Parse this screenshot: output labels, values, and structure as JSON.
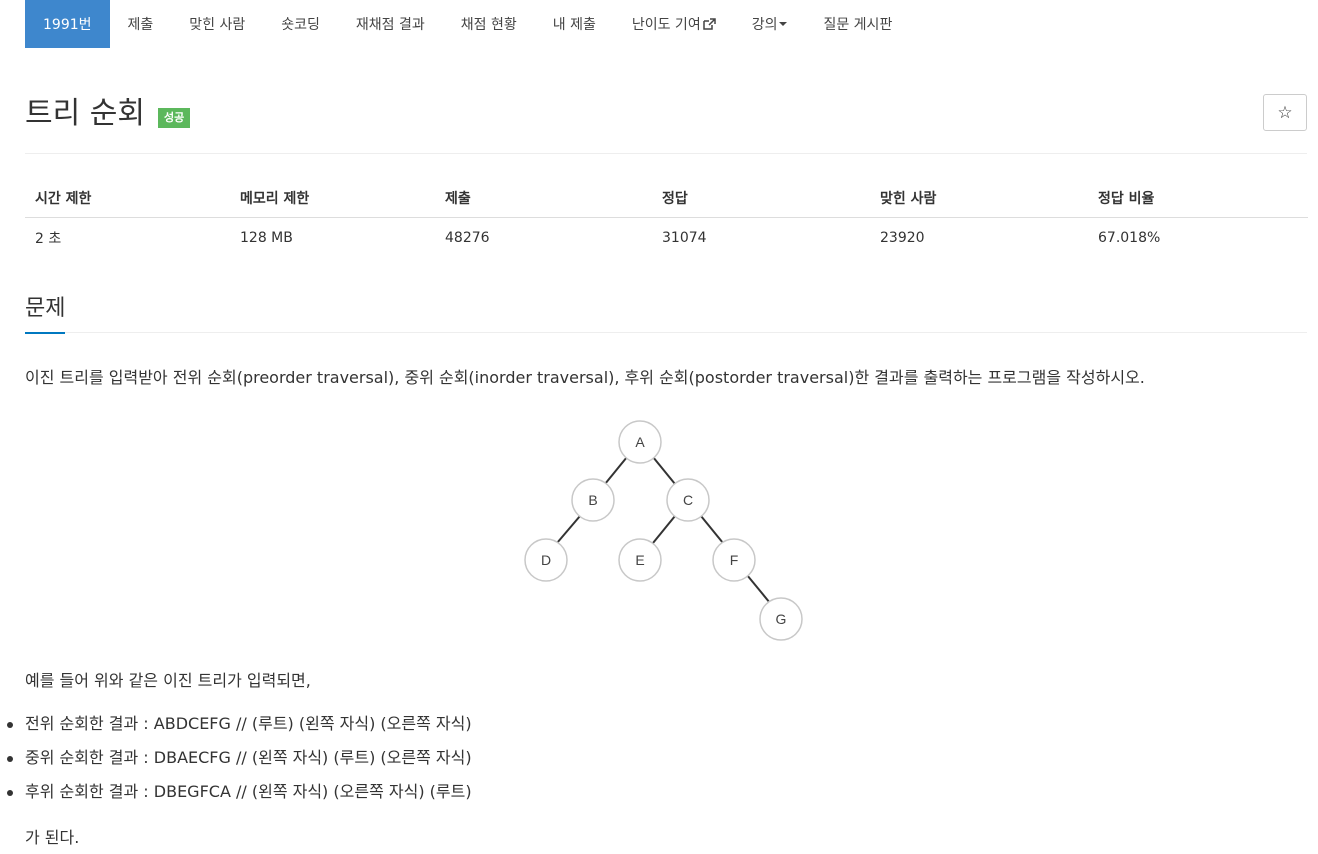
{
  "nav": {
    "tabs": [
      {
        "label": "1991번",
        "active": true
      },
      {
        "label": "제출"
      },
      {
        "label": "맞힌 사람"
      },
      {
        "label": "숏코딩"
      },
      {
        "label": "재채점 결과"
      },
      {
        "label": "채점 현황"
      },
      {
        "label": "내 제출"
      },
      {
        "label": "난이도 기여"
      },
      {
        "label": "강의"
      },
      {
        "label": "질문 게시판"
      }
    ]
  },
  "problem": {
    "title": "트리 순회",
    "badge": "성공",
    "star": "☆"
  },
  "info": {
    "headers": [
      "시간 제한",
      "메모리 제한",
      "제출",
      "정답",
      "맞힌 사람",
      "정답 비율"
    ],
    "values": [
      "2 초",
      "128 MB",
      "48276",
      "31074",
      "23920",
      "67.018%"
    ]
  },
  "section": {
    "title": "문제",
    "description": "이진 트리를 입력받아 전위 순회(preorder traversal), 중위 순회(inorder traversal), 후위 순회(postorder traversal)한 결과를 출력하는 프로그램을 작성하시오.",
    "example_intro": "예를 들어 위와 같은 이진 트리가 입력되면,",
    "results": [
      "전위 순회한 결과 : ABDCEFG // (루트) (왼쪽 자식) (오른쪽 자식)",
      "중위 순회한 결과 : DBAECFG // (왼쪽 자식) (루트) (오른쪽 자식)",
      "후위 순회한 결과 : DBEGFCA // (왼쪽 자식) (오른쪽 자식) (루트)"
    ],
    "ending": "가 된다."
  },
  "tree": {
    "nodes": [
      "A",
      "B",
      "C",
      "D",
      "E",
      "F",
      "G"
    ]
  },
  "colors": {
    "active_tab": "#3e87cd",
    "badge": "#5cb85c",
    "section_underline": "#0078c0"
  }
}
